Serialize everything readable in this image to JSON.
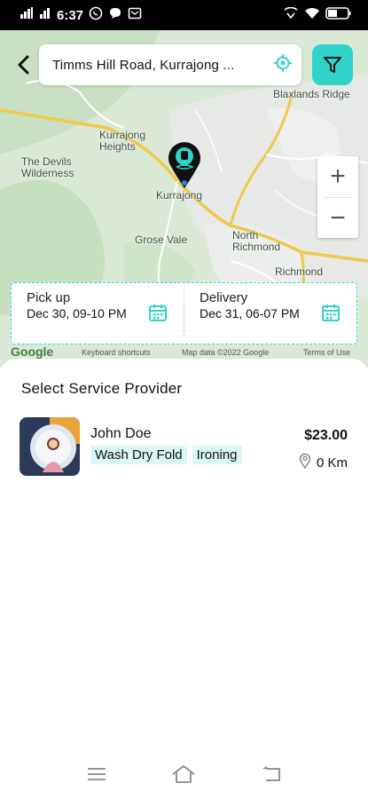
{
  "status_bar": {
    "time": "6:37",
    "battery": "40"
  },
  "search": {
    "address": "Timms Hill Road, Kurrajong ..."
  },
  "map": {
    "places": {
      "blaxlands": "Blaxlands Ridge",
      "kurrajong_heights": "Kurrajong Heights",
      "devils_wilderness": "The Devils Wilderness",
      "kurrajong": "Kurrajong",
      "grose_vale": "Grose Vale",
      "north_richmond": "North Richmond",
      "richmond": "Richmond"
    },
    "footer": {
      "shortcuts": "Keyboard shortcuts",
      "map_data": "Map data ©2022 Google",
      "terms": "Terms of Use"
    },
    "zoom_in": "+",
    "zoom_out": "−",
    "google": "Google"
  },
  "schedule": {
    "pickup": {
      "label": "Pick up",
      "value": "Dec 30, 09-10 PM"
    },
    "delivery": {
      "label": "Delivery",
      "value": "Dec 31, 06-07 PM"
    }
  },
  "sheet": {
    "title": "Select Service Provider",
    "providers": [
      {
        "name": "John Doe",
        "tags": [
          "Wash Dry Fold",
          "Ironing"
        ],
        "price": "$23.00",
        "distance": "0 Km"
      }
    ]
  },
  "colors": {
    "accent": "#2fd3c7",
    "tag_bg": "#d9f7f4",
    "map_bg": "#d6e7d3"
  }
}
